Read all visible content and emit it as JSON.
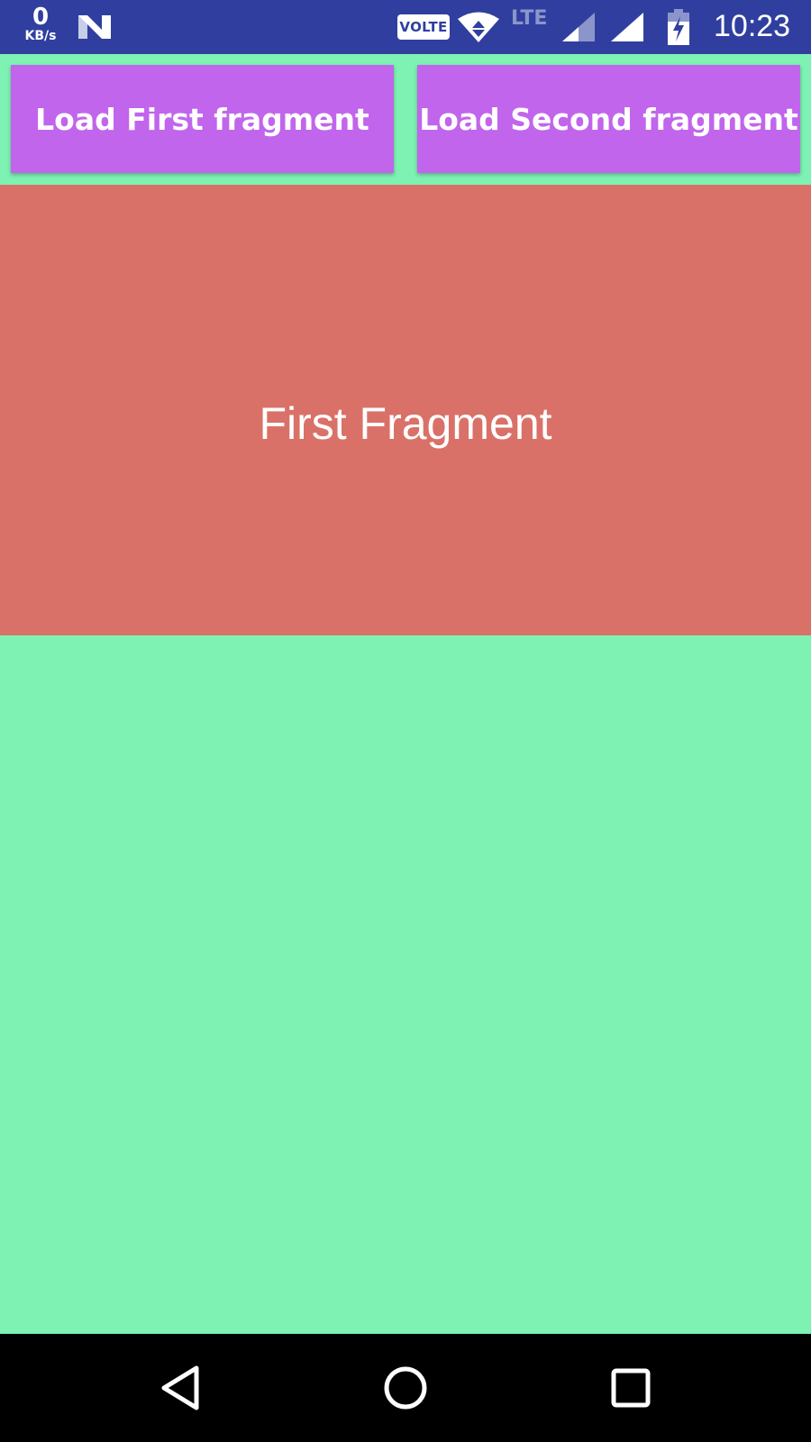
{
  "status_bar": {
    "net_speed_value": "0",
    "net_speed_unit": "KB/s",
    "volte_label": "VOLTE",
    "lte_label": "LTE",
    "time": "10:23",
    "icons": [
      "n-icon",
      "wifi-icon",
      "signal-icon",
      "signal-icon",
      "battery-charging-icon"
    ]
  },
  "buttons": {
    "load_first": "Load First fragment",
    "load_second": "Load Second fragment"
  },
  "fragment": {
    "title": "First Fragment"
  },
  "nav_bar": {
    "icons": [
      "back-icon",
      "home-icon",
      "recents-icon"
    ]
  },
  "colors": {
    "status_bar": "#303f9f",
    "background": "#7df2b2",
    "button": "#c165ec",
    "fragment": "#da7168",
    "nav_bar": "#000000"
  }
}
